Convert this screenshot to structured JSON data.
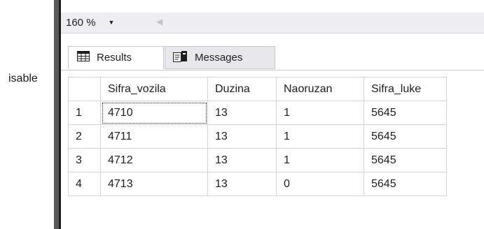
{
  "editor": {
    "visible_text": "isable"
  },
  "zoom": {
    "value": "160 %"
  },
  "tabs": [
    {
      "label": "Results",
      "icon": "grid-icon",
      "active": true
    },
    {
      "label": "Messages",
      "icon": "messages-icon",
      "active": false
    }
  ],
  "grid": {
    "columns": [
      "Sifra_vozila",
      "Duzina",
      "Naoruzan",
      "Sifra_luke"
    ],
    "rows": [
      {
        "num": "1",
        "cells": [
          "4710",
          "13",
          "1",
          "5645"
        ]
      },
      {
        "num": "2",
        "cells": [
          "4711",
          "13",
          "1",
          "5645"
        ]
      },
      {
        "num": "3",
        "cells": [
          "4712",
          "13",
          "1",
          "5645"
        ]
      },
      {
        "num": "4",
        "cells": [
          "4713",
          "13",
          "0",
          "5645"
        ]
      }
    ],
    "selected_cell": "row 1, Sifra_vozila"
  },
  "colors": {
    "toolbar_bg": "#eeeef2",
    "splitter": "#5a5a5a",
    "grid_border": "#d4d4d4"
  }
}
